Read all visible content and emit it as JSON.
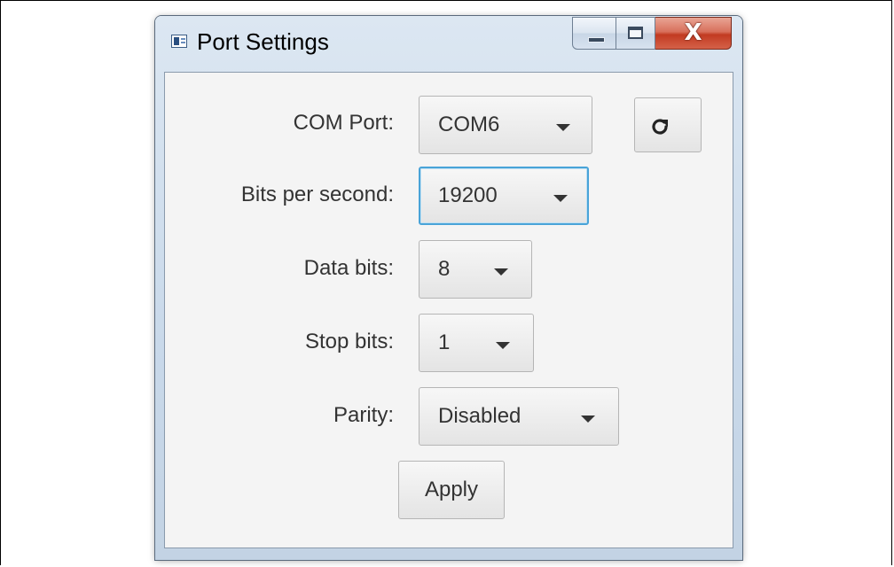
{
  "window": {
    "title": "Port Settings",
    "close_glyph": "X"
  },
  "icons": {
    "app": "app-window-icon",
    "minimize": "minimize-icon",
    "maximize": "maximize-icon",
    "close": "close-icon",
    "refresh": "refresh-icon",
    "dropdown": "chevron-down-icon"
  },
  "form": {
    "com_port": {
      "label": "COM Port:",
      "value": "COM6"
    },
    "bits_per_second": {
      "label": "Bits per second:",
      "value": "19200"
    },
    "data_bits": {
      "label": "Data bits:",
      "value": "8"
    },
    "stop_bits": {
      "label": "Stop bits:",
      "value": "1"
    },
    "parity": {
      "label": "Parity:",
      "value": "Disabled"
    },
    "apply_label": "Apply"
  },
  "colors": {
    "focus_border": "#49a3d8",
    "close_button": "#c23b22",
    "titlebar": "#dce7f2"
  }
}
